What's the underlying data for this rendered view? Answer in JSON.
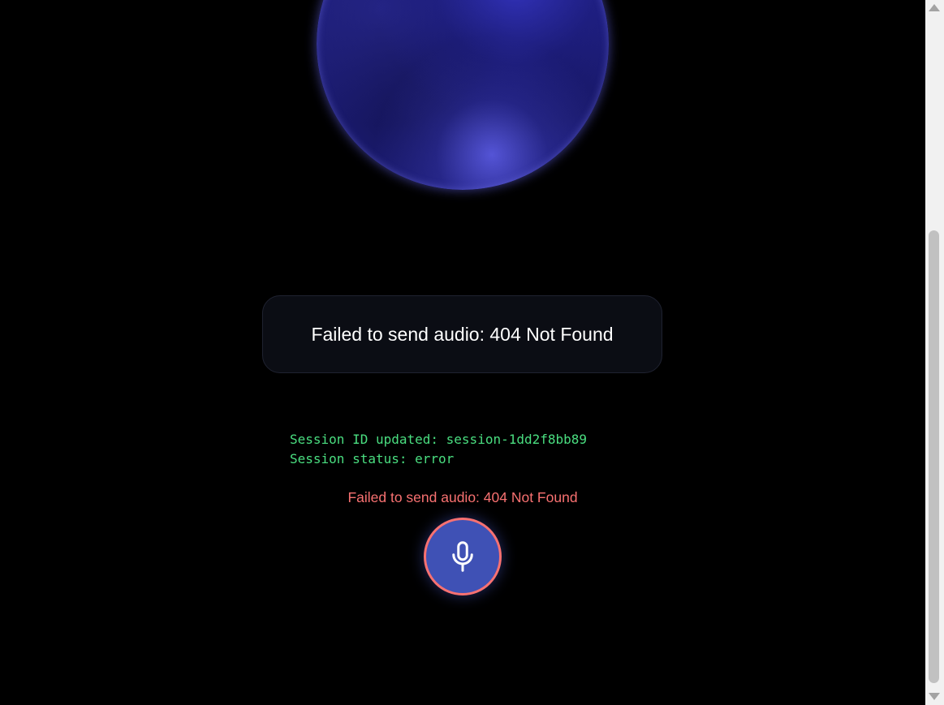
{
  "orb": {
    "icon": "voice-orb"
  },
  "message_card": {
    "text": "Failed to send audio: 404 Not Found"
  },
  "log": {
    "lines": [
      "Session ID updated: session-1dd2f8bb89",
      "Session status: error"
    ]
  },
  "error": {
    "text": "Failed to send audio: 404 Not Found"
  },
  "mic_button": {
    "icon": "microphone-icon"
  },
  "colors": {
    "background": "#000000",
    "log_text": "#4ade80",
    "error_text": "#f87171",
    "mic_fill": "#3f51b5",
    "mic_ring": "#f87171"
  }
}
